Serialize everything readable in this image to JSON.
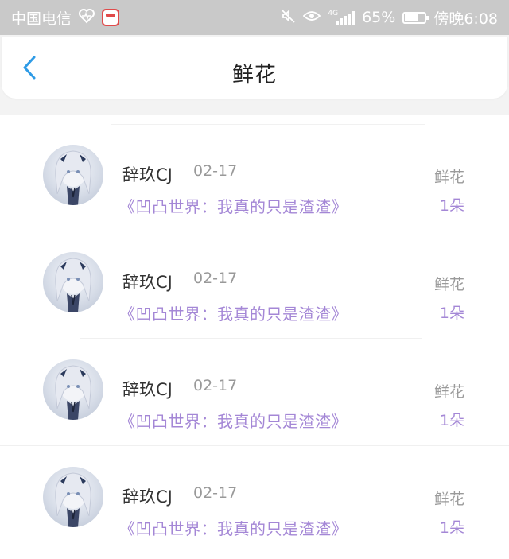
{
  "status_bar": {
    "carrier": "中国电信",
    "network": "4G",
    "battery_text": "65%",
    "battery_level": 0.65,
    "time": "傍晚6:08",
    "color": "#c9c9c9"
  },
  "header": {
    "title": "鲜花",
    "back_icon": "chevron-left-icon",
    "accent": "#2e9be6"
  },
  "rows": [
    {
      "user": "辞玖CJ",
      "date": "02-17",
      "book": "《凹凸世界：我真的只是渣渣》",
      "gift": "鲜花",
      "count": "1朵"
    },
    {
      "user": "辞玖CJ",
      "date": "02-17",
      "book": "《凹凸世界：我真的只是渣渣》",
      "gift": "鲜花",
      "count": "1朵"
    },
    {
      "user": "辞玖CJ",
      "date": "02-17",
      "book": "《凹凸世界：我真的只是渣渣》",
      "gift": "鲜花",
      "count": "1朵"
    },
    {
      "user": "辞玖CJ",
      "date": "02-17",
      "book": "《凹凸世界：我真的只是渣渣》",
      "gift": "鲜花",
      "count": "1朵"
    }
  ],
  "colors": {
    "book_text": "#a487d6",
    "muted_text": "#9a9a9a"
  }
}
